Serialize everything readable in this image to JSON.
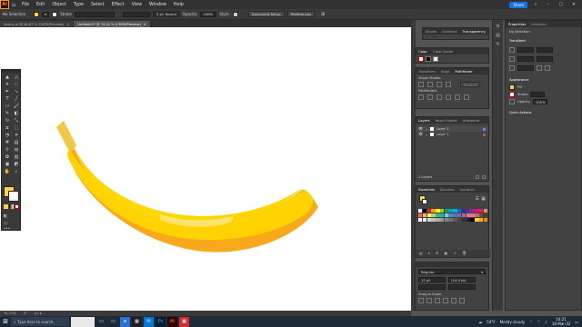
{
  "menubar": {
    "logo": "Ai",
    "items": [
      "File",
      "Edit",
      "Object",
      "Type",
      "Select",
      "Effect",
      "View",
      "Window",
      "Help"
    ],
    "share_label": "Share"
  },
  "control": {
    "selection": "No Selection",
    "stroke_label": "Stroke",
    "brush": "5 pt. Round",
    "opacity_label": "Opacity:",
    "opacity_value": "100%",
    "style_label": "Style:",
    "document_setup": "Document Setup",
    "preferences": "Preferences"
  },
  "tabs": [
    {
      "label": "ilustra_ai @ 66.67 % (CMYK/Preview)"
    },
    {
      "label": "Untitled-1* @ 74.21 % (CMYK/Preview)"
    }
  ],
  "colors": {
    "accent": "#1473e6",
    "fill": "#ffd23f",
    "banana_main": "#ffd700",
    "banana_shade": "#f7a81b",
    "banana_stem": "#f2c744"
  },
  "status": {
    "zoom": "74.21%"
  },
  "transparency_group": {
    "tabs": [
      "Stroke",
      "Gradient",
      "Transparency"
    ]
  },
  "color_panel": {
    "tabs": [
      "Color",
      "Color Guide"
    ]
  },
  "pathfinder": {
    "tabs": [
      "Transform",
      "Align",
      "Pathfinder"
    ],
    "shape_modes_label": "Shape Modes:",
    "pathfinders_label": "Pathfinders:",
    "expand_label": "Expand"
  },
  "layers": {
    "tabs": [
      "Layers",
      "Asset Export",
      "Artboards"
    ],
    "rows": [
      {
        "name": "Layer 2"
      },
      {
        "name": "Layer 1"
      }
    ],
    "footer": "2 Layers"
  },
  "swatches": {
    "tabs": [
      "Swatches",
      "Brushes",
      "Symbols"
    ]
  },
  "character": {
    "font_style": "Regular",
    "size": "12 pt",
    "leading": "(14.4 pt)",
    "snap_label": "Snap to Glyph"
  },
  "properties": {
    "tabs": [
      "Properties",
      "Libraries"
    ],
    "no_selection": "No Selection",
    "transform_label": "Transform",
    "appearance_label": "Appearance",
    "fill_label": "Fill",
    "stroke_label": "Stroke",
    "opacity_label": "Opacity",
    "opacity_value": "100%",
    "quick_actions_label": "Quick Actions"
  },
  "taskbar": {
    "search_placeholder": "Type here to search",
    "weather_temp": "54°F",
    "weather_text": "Mostly cloudy",
    "time": "14:21",
    "date": "16-Mar-22"
  }
}
